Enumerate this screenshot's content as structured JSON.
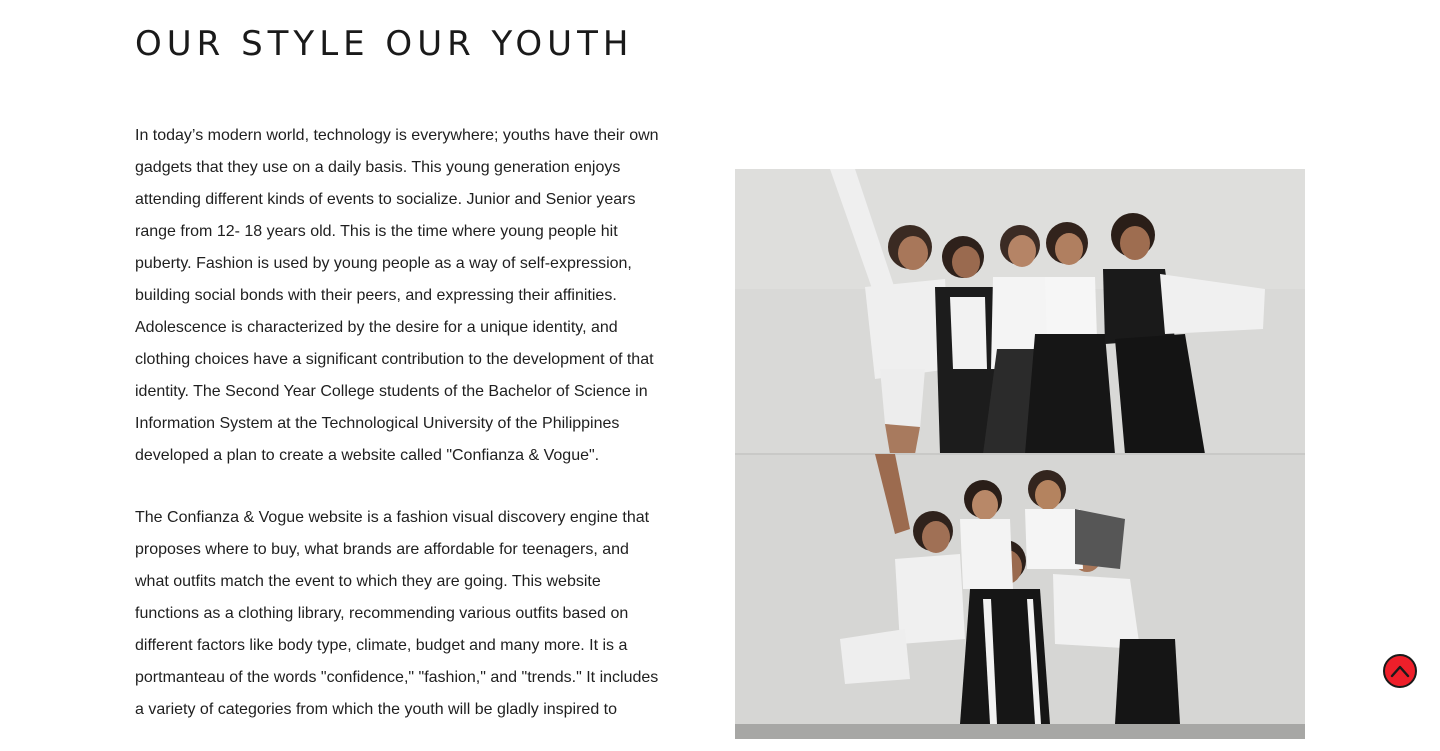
{
  "page": {
    "title": "OUR STYLE OUR YOUTH"
  },
  "content": {
    "paragraphs": [
      "In today’s modern world, technology is everywhere; youths have their own gadgets that they use on a daily basis. This young generation enjoys attending different kinds of events to socialize. Junior and Senior years range from 12- 18 years old. This is the time where young people hit puberty. Fashion is used by young people as a way of self-expression, building social bonds with their peers, and expressing their affinities. Adolescence is characterized by the desire for a unique identity, and clothing choices have a significant contribution to the development of that identity. The Second Year College students of the Bachelor of Science in Information System at the Technological University of the Philippines developed a plan to create a website called \"Confianza & Vogue\".",
      "The Confianza & Vogue website is a fashion visual discovery engine that proposes where to buy, what brands are affordable for teenagers, and what outfits match the event to which they are going. This website functions as a clothing library, recommending various outfits based on different factors like body type, climate, budget and many more. It is a portmanteau of the words \"confidence,\" \"fashion,\" and \"trends.\" It includes a variety of categories from which the youth will be gladly inspired to"
    ]
  },
  "photo": {
    "description_icon": "group-photo"
  },
  "scroll_top": {
    "icon": "chevron-up-icon",
    "color": "#ee1f2a"
  },
  "colors": {
    "background": "#ffffff",
    "text": "#1f1f1f",
    "accent": "#ee1f2a"
  }
}
